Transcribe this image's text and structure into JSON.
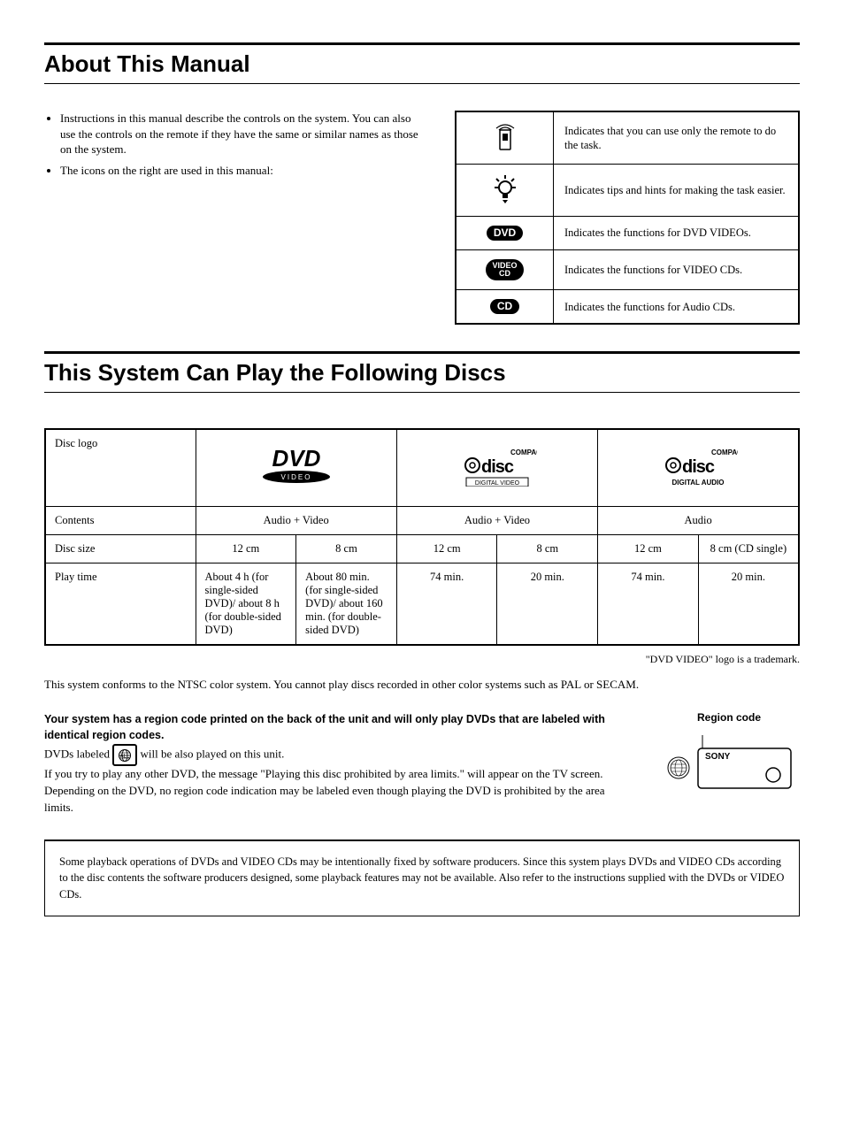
{
  "section1": {
    "title": "About This Manual",
    "bullets": [
      "Instructions in this manual describe the controls on the system. You can also use the controls on the remote if they have the same or similar names as those on the system.",
      "The icons on the right are used in this manual:"
    ],
    "icon_table": [
      {
        "icon": "remote",
        "text": "Indicates that you can use only the remote to do the task."
      },
      {
        "icon": "tip",
        "text": "Indicates tips and hints for making the task easier."
      },
      {
        "icon": "dvd",
        "label": "DVD",
        "text": "Indicates the functions for DVD VIDEOs."
      },
      {
        "icon": "vcd",
        "label": "VIDEO\nCD",
        "text": "Indicates the functions for VIDEO CDs."
      },
      {
        "icon": "cd",
        "label": "CD",
        "text": "Indicates the functions for Audio CDs."
      }
    ]
  },
  "section2": {
    "title": "This System Can Play the Following Discs",
    "row_headers": [
      "Disc logo",
      "Contents",
      "Disc size",
      "Play time"
    ],
    "logos": [
      "dvd-video",
      "compact-disc-digital-video",
      "compact-disc-digital-audio"
    ],
    "contents": [
      "Audio + Video",
      "Audio + Video",
      "Audio"
    ],
    "sizes": [
      "12 cm",
      "8 cm",
      "12 cm",
      "8 cm",
      "12 cm",
      "8 cm (CD single)"
    ],
    "playtimes": [
      "About 4 h (for single-sided DVD)/ about 8 h (for double-sided DVD)",
      "About 80 min. (for single-sided DVD)/ about 160 min. (for double-sided DVD)",
      "74 min.",
      "20 min.",
      "74 min.",
      "20 min."
    ],
    "trademark": "\"DVD VIDEO\" logo is a trademark.",
    "ntsc_note": "This system conforms to the NTSC color system.  You cannot play discs recorded in other color systems such as PAL or SECAM.",
    "region": {
      "heading": "Your system has a region code printed on the back of the unit and will only play DVDs that are labeled with identical region codes.",
      "line_all_pre": "DVDs labeled ",
      "line_all_post": " will be also played on this unit.",
      "line_other": "If you try to play any other DVD, the message \"Playing this disc prohibited by area limits.\" will appear on the TV screen.",
      "line_depend": "Depending on the DVD, no region code indication may be labeled even though playing the DVD is prohibited by the area limits.",
      "label": "Region code",
      "brand": "SONY"
    },
    "note_box": "Some playback operations of DVDs and VIDEO CDs may be intentionally fixed by software producers.  Since this system plays DVDs and VIDEO CDs according to the disc contents the software producers designed, some playback features may not be available. Also refer to the instructions supplied with the DVDs or VIDEO CDs."
  }
}
